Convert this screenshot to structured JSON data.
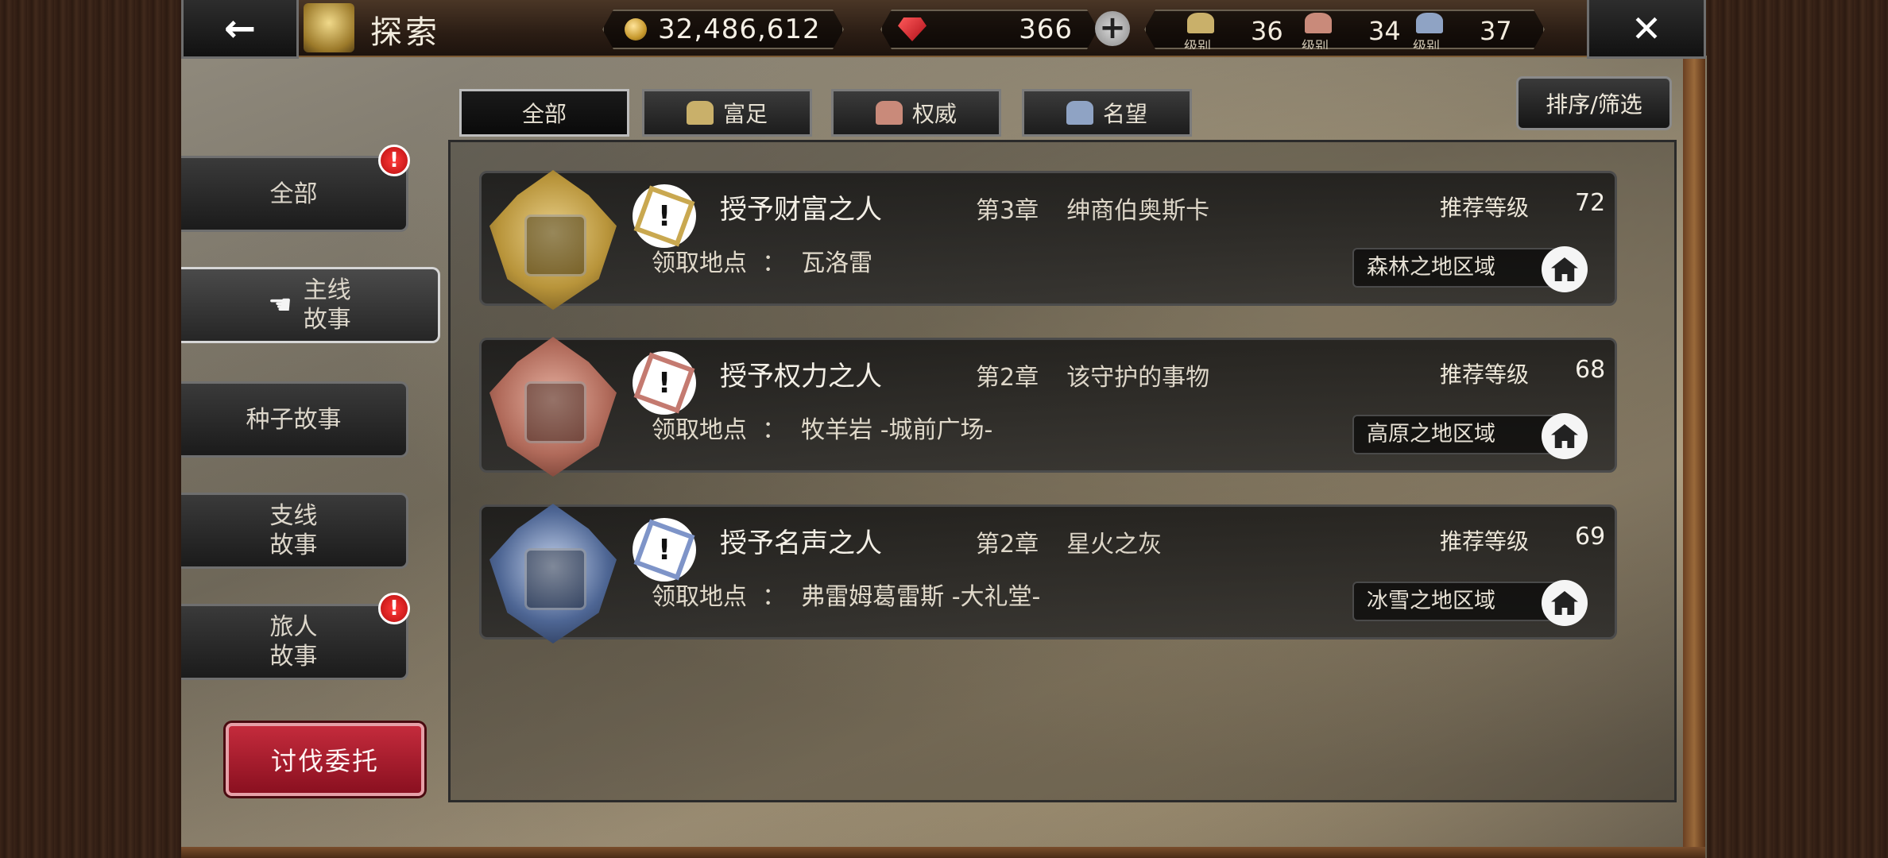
{
  "header": {
    "back_icon": "←",
    "title": "探索",
    "close_icon": "✕",
    "gold": "32,486,612",
    "gems": "366",
    "plus": "+",
    "ranks": [
      {
        "label": "级别",
        "value": "36",
        "color": "#c9b06a"
      },
      {
        "label": "级别",
        "value": "34",
        "color": "#c98a7a"
      },
      {
        "label": "级别",
        "value": "37",
        "color": "#8fa3c4"
      }
    ]
  },
  "tabs": [
    {
      "label": "全部",
      "icon": "",
      "active": true
    },
    {
      "label": "富足",
      "icon": "wealth-icon",
      "color": "#c9b06a"
    },
    {
      "label": "权威",
      "icon": "authority-icon",
      "color": "#c98a7a"
    },
    {
      "label": "名望",
      "icon": "fame-icon",
      "color": "#8fa3c4"
    }
  ],
  "sort_label": "排序/筛选",
  "categories": [
    {
      "label": "全部",
      "alert": "!"
    },
    {
      "label": "主线\n故事",
      "hand": "☚"
    },
    {
      "label": "种子故事"
    },
    {
      "label": "支线\n故事"
    },
    {
      "label": "旅人\n故事",
      "alert": "!"
    }
  ],
  "hunt_button": "讨伐委托",
  "quests": [
    {
      "name": "授予财富之人",
      "chapter": "第3章",
      "chapter_title": "绅商伯奥斯卡",
      "level_label": "推荐等级",
      "level": "72",
      "location_label": "领取地点",
      "location_sep": "：",
      "location": "瓦洛雷",
      "region": "森林之地区域",
      "accent": "#c9a850",
      "emblem_color": "#b8943a"
    },
    {
      "name": "授予权力之人",
      "chapter": "第2章",
      "chapter_title": "该守护的事物",
      "level_label": "推荐等级",
      "level": "68",
      "location_label": "领取地点",
      "location_sep": "：",
      "location": "牧羊岩 -城前广场-",
      "region": "高原之地区域",
      "accent": "#c47a70",
      "emblem_color": "#b06a5a"
    },
    {
      "name": "授予名声之人",
      "chapter": "第2章",
      "chapter_title": "星火之灰",
      "level_label": "推荐等级",
      "level": "69",
      "location_label": "领取地点",
      "location_sep": "：",
      "location": "弗雷姆葛雷斯 -大礼堂-",
      "region": "冰雪之地区域",
      "accent": "#7e94c8",
      "emblem_color": "#4e6694"
    }
  ]
}
